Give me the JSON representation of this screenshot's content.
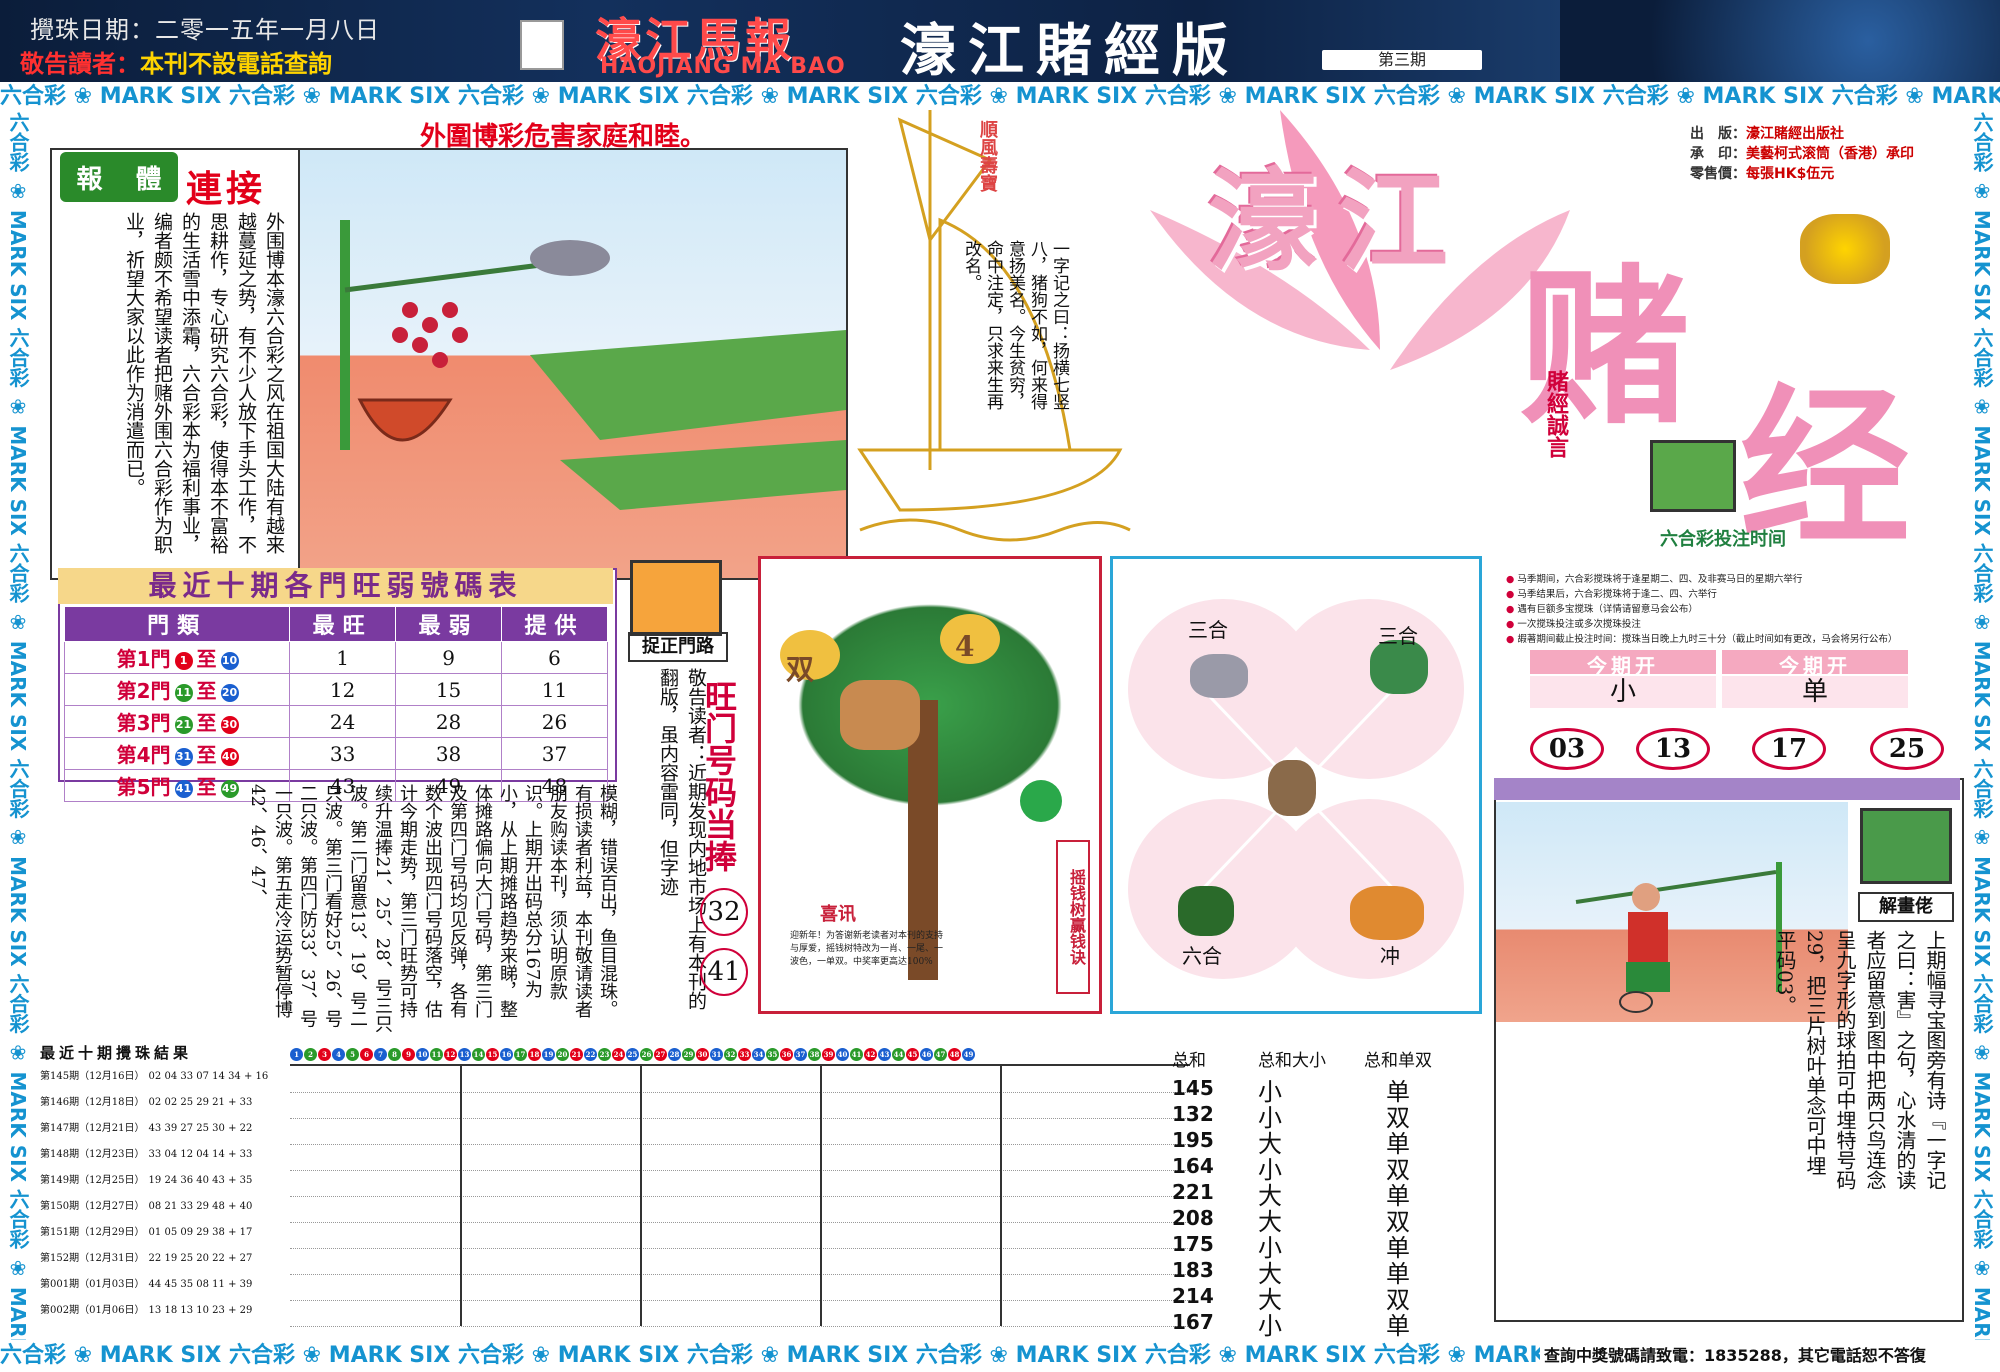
{
  "header": {
    "draw_date": "攪珠日期：二零一五年一月八日",
    "notice_label": "敬告讀者：",
    "notice_text": "本刊不設電話查詢",
    "logo_cn": "濠江馬報",
    "logo_en": "HAOJIANG MA BAO",
    "title": "濠江賭經版",
    "issue": "第三期"
  },
  "strip_text": "六合彩 ❀ MARK SIX 六合彩 ❀ MARK SIX 六合彩 ❀ MARK SIX 六合彩 ❀ MARK SIX 六合彩 ❀ MARK SIX 六合彩 ❀ MARK SIX 六合彩 ❀ MARK SIX 六合彩 ❀ MARK SIX 六合彩 ❀ MARK SIX 六合彩 ❀ MARK SIX",
  "warning_title": "外圍博彩危害家庭和睦。",
  "report": {
    "badge_a": "報",
    "badge_b": "體",
    "connect": "連接",
    "text": "外围博本濠六合彩之风在祖国大陆有越来越蔓延之势，有不少人放下手头工作，不思耕作，专心研究六合彩，使得本不富裕的生活雪中添霜，六合彩本为福利事业，编者颇不希望读者把赌外围六合彩作为职业，祈望大家以此作为消遣而已。"
  },
  "ship": {
    "flag": "順風壽寶",
    "poem": "一字记之曰：扬横七竖八，猪狗不如，何来得意扬美名。今生贫穷，命中注定，只求来生再改名。"
  },
  "publisher": {
    "publish_k": "出　版：",
    "publish_v": "濠江賭經出版社",
    "print_k": "承　印：",
    "print_v": "美藝柯式滚筒（香港）承印",
    "price_k": "零售價：",
    "price_v": "每張HK$伍元"
  },
  "big_title": {
    "haojiang": "濠江",
    "du": "赌",
    "jing": "经",
    "motto": "賭經誠言"
  },
  "bet_time_title": "六合彩投注时间",
  "bet_notes": [
    "马季期间，六合彩搅珠将于逢星期二、四、及非赛马日的星期六举行",
    "马季结果后，六合彩搅珠将于逢二、四、六举行",
    "遇有巨额多宝搅珠（详情请留意马会公布）",
    "一次搅珠投注或多次搅珠投注",
    "嘏著期间截止投注时间：搅珠当日晚上九时三十分（截止时间如有更改，马会将另行公布）"
  ],
  "kaiban": {
    "head1": "今期开",
    "val1": "小",
    "head2": "今期开",
    "val2": "单"
  },
  "results": [
    "03",
    "13",
    "17",
    "25"
  ],
  "hot_cold": {
    "title": "最近十期各門旺弱號碼表",
    "headers": [
      "門類",
      "最旺",
      "最弱",
      "提供"
    ],
    "rows": [
      {
        "door": "第1門",
        "from": "1",
        "to": "10",
        "hot": "1",
        "cold": "9",
        "offer": "6",
        "c1": "#e2001a",
        "c2": "#1a5fd0"
      },
      {
        "door": "第2門",
        "from": "11",
        "to": "20",
        "hot": "12",
        "cold": "15",
        "offer": "11",
        "c1": "#2a9a2a",
        "c2": "#1a5fd0"
      },
      {
        "door": "第3門",
        "from": "21",
        "to": "30",
        "hot": "24",
        "cold": "28",
        "offer": "26",
        "c1": "#2a9a2a",
        "c2": "#e2001a"
      },
      {
        "door": "第4門",
        "from": "31",
        "to": "40",
        "hot": "33",
        "cold": "38",
        "offer": "37",
        "c1": "#1a5fd0",
        "c2": "#e2001a"
      },
      {
        "door": "第5門",
        "from": "41",
        "to": "49",
        "hot": "43",
        "cold": "49",
        "offer": "48",
        "c1": "#1a5fd0",
        "c2": "#2a9a2a"
      }
    ],
    "to_word": "至"
  },
  "zhuozheng": {
    "label": "捉正門路",
    "text": "敬告读者：近期发现内地市场上有本刊的翻版，虽内容雷同，但字迹"
  },
  "hot_numbers": {
    "title": "旺门号码当捧",
    "n1": "32",
    "n2": "41"
  },
  "column_text": "模糊，错误百出，鱼目混珠。有损读者利益，本刊敬请读者朋友购读本刊，须认明原款识。上期开出码总分167为小，从上期摊路趋势来睇，整体摊路偏向大门号码，第三门及第四门号码均见反弹，各有数个波出现四门号码落空，估计今期走势，第三门旺势可持续升温捧21、25、28、号三只波。第二门留意13、19、号二只波。第三门看好25、26、号二只波。第四门防33、37、号一只波。第五走冷运势暂停博42、46、47、",
  "tree": {
    "shuang": "双",
    "four": "4",
    "xixun": "喜讯",
    "xixun_body": "迎新年！为答谢新老读者对本刊的支持与厚爱，摇钱树特改为一肖、一尾、一波色，一单双。中奖率更高达100%",
    "label": "摇钱树赢钱诀"
  },
  "zodiac": {
    "sanhe1": "三合",
    "sanhe2": "三合",
    "liuhe": "六合",
    "chong": "冲"
  },
  "jiehualao": {
    "label": "解畫佬",
    "text": "上期幅寻宝图旁有诗『一字记之曰：害』之句，心水清的读者应留意到图中把两只鸟连念呈九字形的球拍可中埋特号码29，把三片树叶单念可中埋平码03。"
  },
  "draw_results": {
    "title": "最近十期攪珠結果",
    "sum_h": "总和",
    "big_h": "总和大小",
    "odd_h": "总和单双",
    "rows": [
      {
        "issue": "第145期（12月16日）",
        "nums": "02 04 33 07 14 34 + 16",
        "sum": "145",
        "bs": "小",
        "oe": "单"
      },
      {
        "issue": "第146期（12月18日）",
        "nums": "02 02 25 29 21 + 33",
        "sum": "132",
        "bs": "小",
        "oe": "双"
      },
      {
        "issue": "第147期（12月21日）",
        "nums": "43 39 27 25 30 + 22",
        "sum": "195",
        "bs": "大",
        "oe": "单"
      },
      {
        "issue": "第148期（12月23日）",
        "nums": "33 04 12 04 14 + 33",
        "sum": "164",
        "bs": "小",
        "oe": "双"
      },
      {
        "issue": "第149期（12月25日）",
        "nums": "19 24 36 40 43 + 35",
        "sum": "221",
        "bs": "大",
        "oe": "单"
      },
      {
        "issue": "第150期（12月27日）",
        "nums": "08 21 33 29 48 + 40",
        "sum": "208",
        "bs": "大",
        "oe": "双"
      },
      {
        "issue": "第151期（12月29日）",
        "nums": "01 05 09 29 38 + 17",
        "sum": "175",
        "bs": "小",
        "oe": "单"
      },
      {
        "issue": "第152期（12月31日）",
        "nums": "22 19 25 20 22 + 27",
        "sum": "183",
        "bs": "大",
        "oe": "单"
      },
      {
        "issue": "第001期（01月03日）",
        "nums": "44 45 35 08 11 + 39",
        "sum": "214",
        "bs": "大",
        "oe": "双"
      },
      {
        "issue": "第002期（01月06日）",
        "nums": "13 18 13 10 23 + 29",
        "sum": "167",
        "bs": "小",
        "oe": "单"
      }
    ]
  },
  "hotline": "查詢中獎號碼請致電：1835288，其它電話恕不答復",
  "colors": {
    "red": "#e2001a",
    "blue": "#1593d0",
    "pink": "#f090b8",
    "purple": "#7a3aa0"
  }
}
